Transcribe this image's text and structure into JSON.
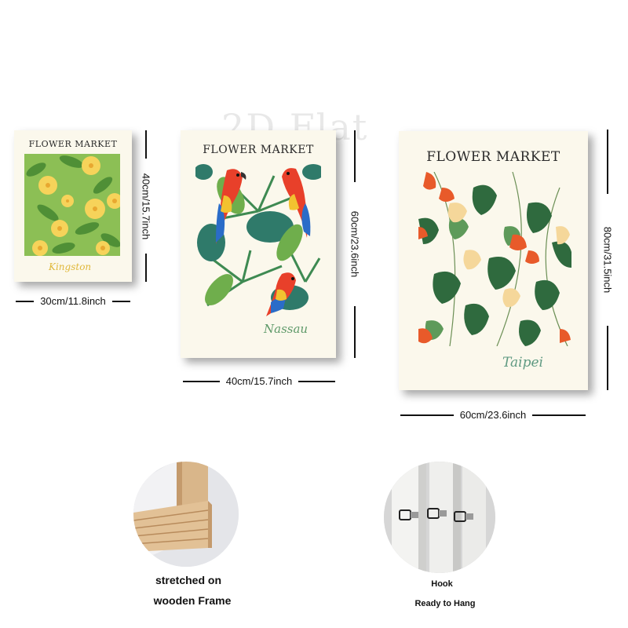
{
  "watermark": "2D Flat",
  "posters": [
    {
      "title": "FLOWER MARKET",
      "city": "Kingston",
      "width_label": "30cm/11.8inch",
      "height_label": "40cm/15.7inch",
      "city_color": "#e0b83a"
    },
    {
      "title": "FLOWER MARKET",
      "city": "Nassau",
      "width_label": "40cm/15.7inch",
      "height_label": "60cm/23.6inch",
      "city_color": "#5f9a6a"
    },
    {
      "title": "FLOWER MARKET",
      "city": "Taipei",
      "width_label": "60cm/23.6inch",
      "height_label": "80cm/31.5inch",
      "city_color": "#5f9a82"
    }
  ],
  "features": [
    {
      "line1": "stretched on",
      "line2": "wooden Frame"
    },
    {
      "line1": "Hook",
      "line2": "Ready to Hang"
    }
  ]
}
